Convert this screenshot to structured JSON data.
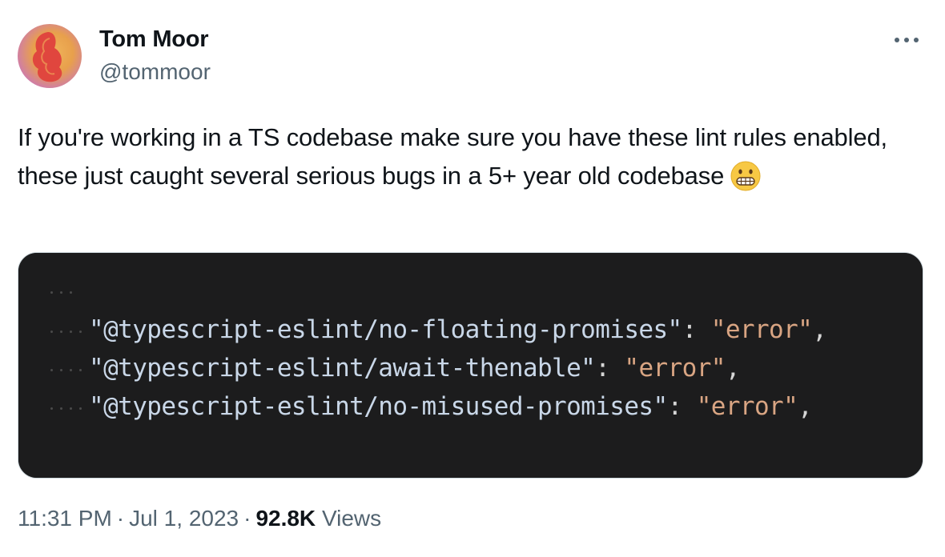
{
  "author": {
    "name": "Tom Moor",
    "handle": "@tommoor"
  },
  "tweet": {
    "text": "If you're working in a TS codebase make sure you have these lint rules enabled, these just caught several serious bugs in a 5+ year old codebase",
    "emoji": "grimacing-face"
  },
  "media": {
    "code_lines": [
      {
        "key": "\"@typescript-eslint/no-floating-promises\"",
        "punct": ": ",
        "value": "\"error\"",
        "trail": ","
      },
      {
        "key": "\"@typescript-eslint/await-thenable\"",
        "punct": ": ",
        "value": "\"error\"",
        "trail": ","
      },
      {
        "key": "\"@typescript-eslint/no-misused-promises\"",
        "punct": ": ",
        "value": "\"error\"",
        "trail": ","
      }
    ],
    "colors": {
      "background": "#1c1c1d",
      "key": "#c9d7e8",
      "value": "#d9a583"
    }
  },
  "footer": {
    "time": "11:31 PM",
    "separator": "·",
    "date": "Jul 1, 2023",
    "views_count": "92.8K",
    "views_label": "Views"
  },
  "icons": {
    "more": "more-horizontal-icon"
  }
}
